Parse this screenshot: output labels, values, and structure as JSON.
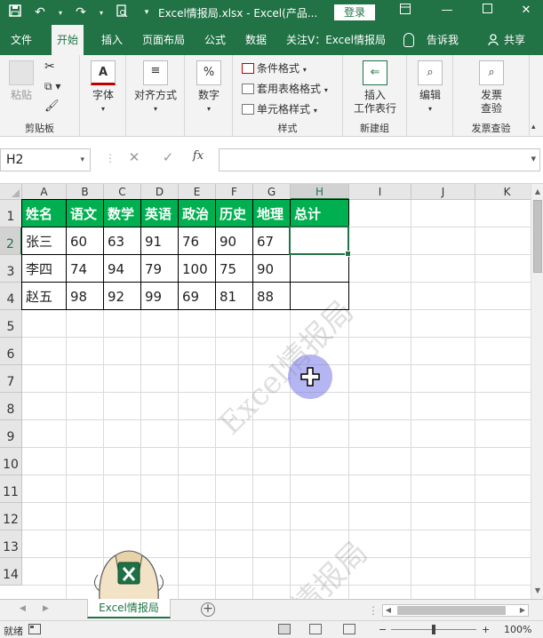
{
  "titlebar": {
    "doc_title": "Excel情报局.xlsx - Excel(产品...",
    "login_label": "登录"
  },
  "tabs": [
    {
      "label": "文件",
      "active": false
    },
    {
      "label": "开始",
      "active": true
    },
    {
      "label": "插入",
      "active": false
    },
    {
      "label": "页面布局",
      "active": false
    },
    {
      "label": "公式",
      "active": false
    },
    {
      "label": "数据",
      "active": false
    },
    {
      "label": "关注V：Excel情报局",
      "active": false
    }
  ],
  "tell_me": "告诉我",
  "share": "共享",
  "ribbon": {
    "clipboard": {
      "paste": "粘贴",
      "group": "剪贴板"
    },
    "font": {
      "label": "字体",
      "icon_text": "A"
    },
    "alignment": {
      "label": "对齐方式"
    },
    "number": {
      "label": "数字",
      "icon_text": "%"
    },
    "styles": {
      "conditional": "条件格式",
      "table_format": "套用表格格式",
      "cell_style": "单元格样式",
      "group": "样式"
    },
    "cells": {
      "label1": "插入",
      "label2": "工作表行",
      "group": "新建组"
    },
    "editing": {
      "label": "编辑"
    },
    "invoice": {
      "label1": "发票",
      "label2": "查验",
      "group": "发票查验"
    }
  },
  "formula_bar": {
    "name_box": "H2",
    "fx": "fx",
    "formula": ""
  },
  "columns": [
    "A",
    "B",
    "C",
    "D",
    "E",
    "F",
    "G",
    "H",
    "I",
    "J",
    "K"
  ],
  "rows": [
    "1",
    "2",
    "3",
    "4",
    "5",
    "6",
    "7",
    "8",
    "9",
    "10",
    "11",
    "12",
    "13",
    "14"
  ],
  "table": {
    "headers": [
      "姓名",
      "语文",
      "数学",
      "英语",
      "政治",
      "历史",
      "地理",
      "总计"
    ],
    "rows": [
      [
        "张三",
        "60",
        "63",
        "91",
        "76",
        "90",
        "67",
        ""
      ],
      [
        "李四",
        "74",
        "94",
        "79",
        "100",
        "75",
        "90",
        ""
      ],
      [
        "赵五",
        "98",
        "92",
        "99",
        "69",
        "81",
        "88",
        ""
      ]
    ]
  },
  "watermark": "Excel情报局",
  "watermark_bottom": "情报局",
  "sheet_tab": "Excel情报局",
  "status": {
    "ready": "就绪",
    "zoom": "100%",
    "zoom_minus": "−",
    "zoom_plus": "+"
  },
  "colors": {
    "brand": "#217346",
    "header_fill": "#00b050"
  }
}
